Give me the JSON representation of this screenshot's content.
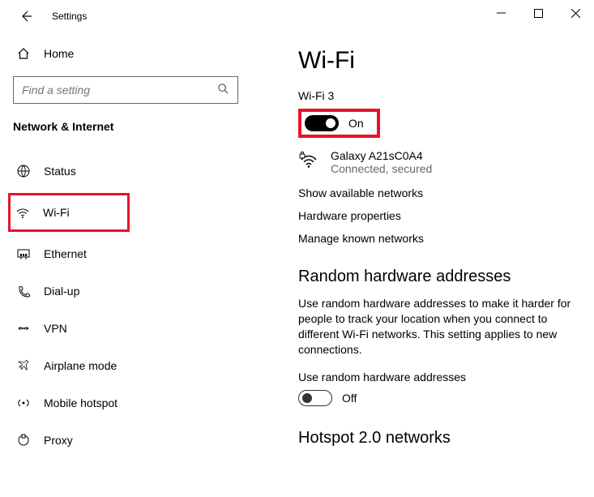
{
  "titlebar": {
    "title": "Settings"
  },
  "sidebar": {
    "home": "Home",
    "search_placeholder": "Find a setting",
    "category": "Network & Internet",
    "items": [
      {
        "label": "Status"
      },
      {
        "label": "Wi-Fi"
      },
      {
        "label": "Ethernet"
      },
      {
        "label": "Dial-up"
      },
      {
        "label": "VPN"
      },
      {
        "label": "Airplane mode"
      },
      {
        "label": "Mobile hotspot"
      },
      {
        "label": "Proxy"
      }
    ]
  },
  "main": {
    "heading": "Wi-Fi",
    "adapter_label": "Wi-Fi 3",
    "toggle_on": "On",
    "network": {
      "name": "Galaxy A21sC0A4",
      "status": "Connected, secured"
    },
    "links": {
      "show_available": "Show available networks",
      "hardware_props": "Hardware properties",
      "manage_known": "Manage known networks"
    },
    "random_hw": {
      "heading": "Random hardware addresses",
      "desc": "Use random hardware addresses to make it harder for people to track your location when you connect to different Wi-Fi networks. This setting applies to new connections.",
      "toggle_label": "Use random hardware addresses",
      "toggle_state": "Off"
    },
    "hotspot": {
      "heading": "Hotspot 2.0 networks"
    }
  }
}
